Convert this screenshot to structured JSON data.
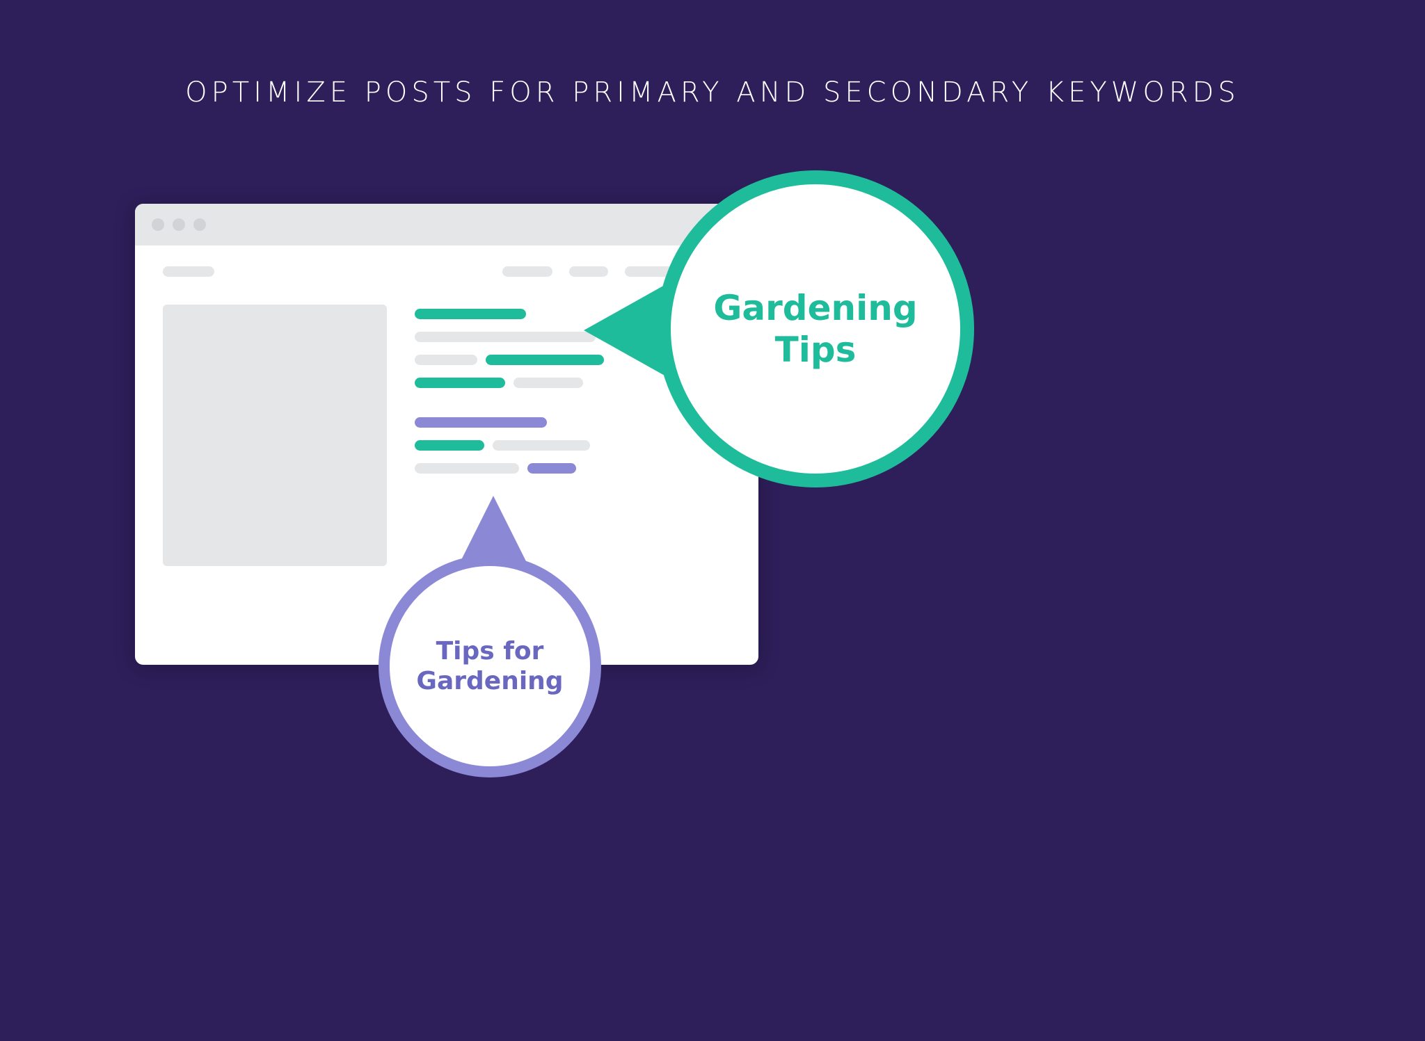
{
  "title": "OPTIMIZE POSTS FOR PRIMARY AND SECONDARY KEYWORDS",
  "primary": {
    "label": "Gardening Tips"
  },
  "secondary": {
    "label": "Tips for Gardening"
  },
  "colors": {
    "primary": "#1fbc9c",
    "secondary": "#8b88d6",
    "bg": "#2e1e5a"
  },
  "icons": {
    "dot": "window-control-dot"
  }
}
